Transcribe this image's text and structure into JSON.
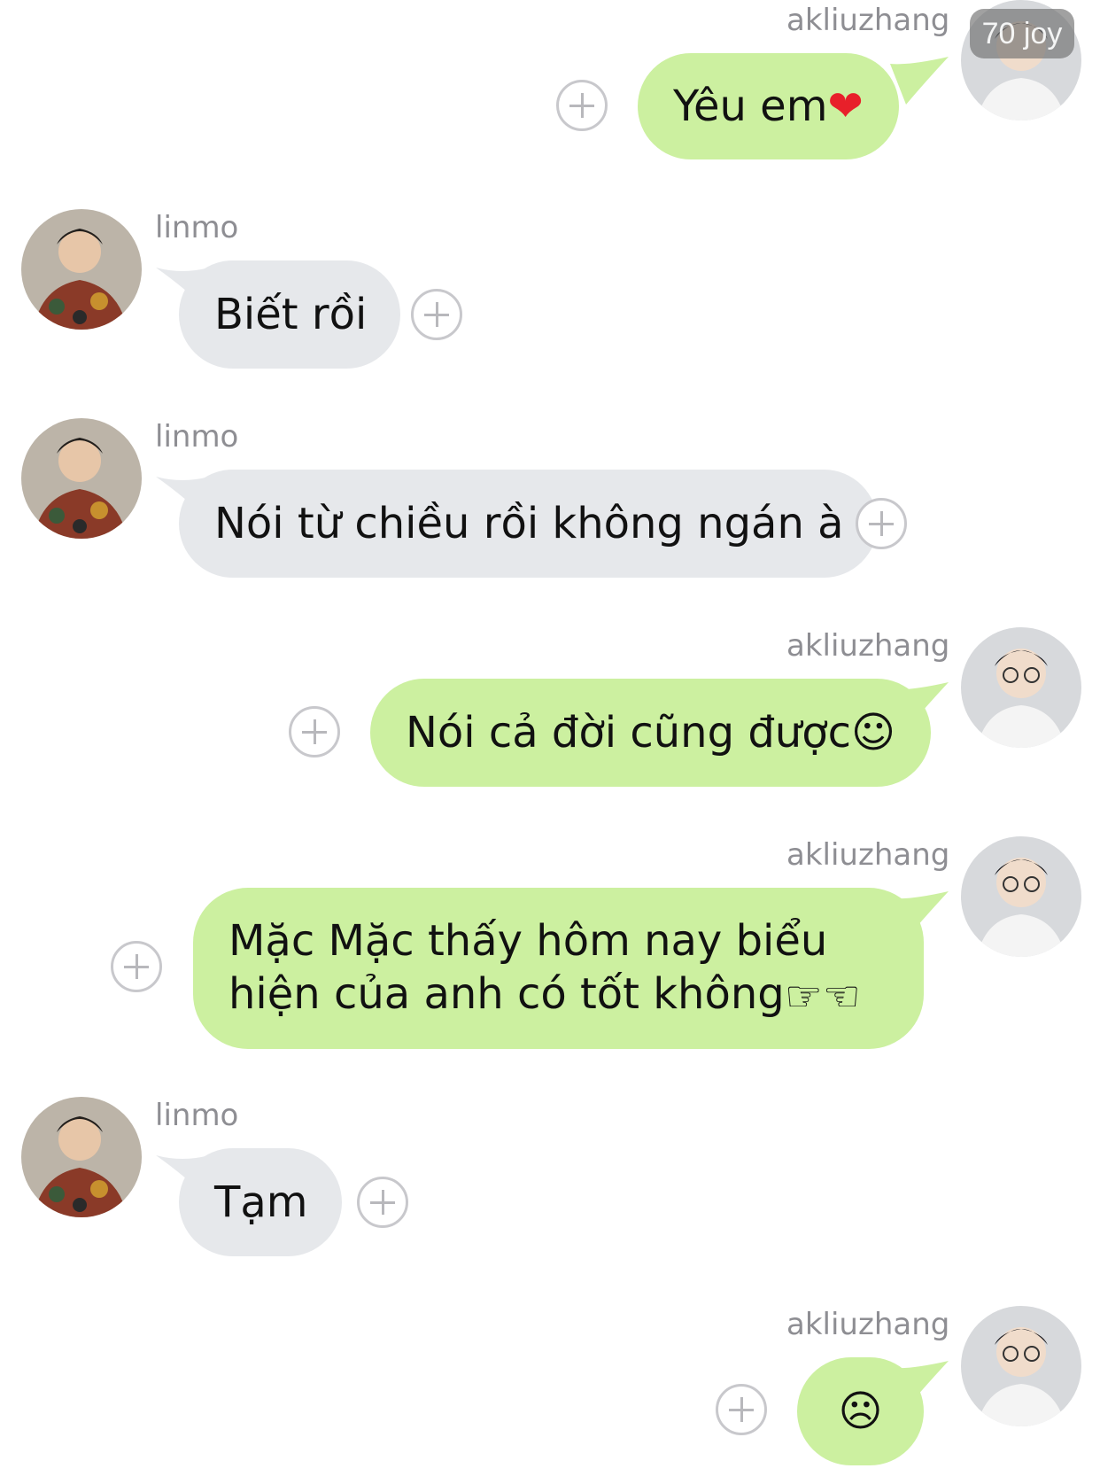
{
  "watermark": "70 joy",
  "users": {
    "me": "akliuzhang",
    "other": "linmo"
  },
  "messages": [
    {
      "sender": "akliuzhang",
      "direction": "outgoing",
      "text": "Yêu em ",
      "emoji": "❤️"
    },
    {
      "sender": "linmo",
      "direction": "incoming",
      "text": "Biết rồi",
      "emoji": ""
    },
    {
      "sender": "linmo",
      "direction": "incoming",
      "text": "Nói từ chiều rồi không ngán à",
      "emoji": ""
    },
    {
      "sender": "akliuzhang",
      "direction": "outgoing",
      "text": "Nói cả đời cũng được",
      "emoji": "🥰"
    },
    {
      "sender": "akliuzhang",
      "direction": "outgoing",
      "text": "Mặc Mặc thấy hôm nay biểu hiện của anh có tốt không",
      "emoji": "👉👈"
    },
    {
      "sender": "linmo",
      "direction": "incoming",
      "text": "Tạm",
      "emoji": ""
    },
    {
      "sender": "akliuzhang",
      "direction": "outgoing",
      "text": "",
      "emoji": "😔"
    }
  ],
  "colors": {
    "outgoing_bubble": "#ccf0a0",
    "incoming_bubble": "#e6e8eb",
    "username": "#8e8e93",
    "plus_icon": "#c8c8cc"
  }
}
